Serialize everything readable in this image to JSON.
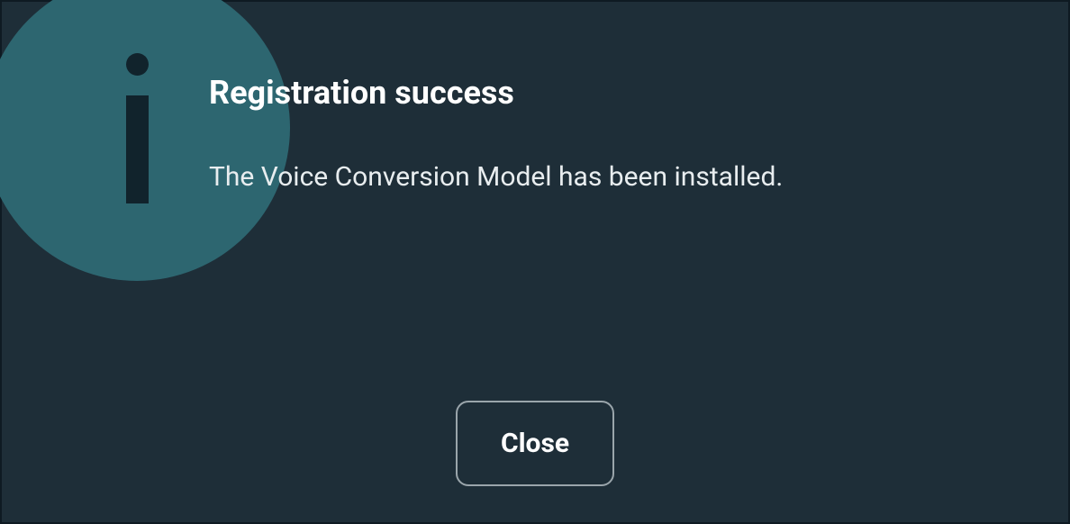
{
  "dialog": {
    "title": "Registration success",
    "message": "The Voice Conversion Model has been installed.",
    "close_label": "Close",
    "icon": "info-icon"
  }
}
